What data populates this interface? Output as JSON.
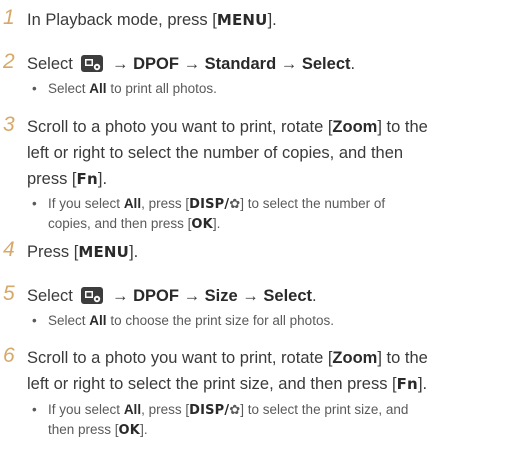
{
  "steps": [
    {
      "num": "1",
      "parts": [
        "In Playback mode, press [",
        "MENU",
        "]."
      ]
    },
    {
      "num": "2",
      "parts": [
        "Select",
        "→",
        "DPOF",
        "→",
        "Standard",
        "→",
        "Select",
        "."
      ],
      "icon": "print-settings-icon",
      "sub": [
        "Select",
        "All",
        "to print all photos."
      ]
    },
    {
      "num": "3",
      "lines": [
        "Scroll to a photo you want to print, rotate [",
        "Zoom",
        "] to the",
        "left or right to select the number of copies, and then",
        "press [",
        "Fn",
        "]."
      ],
      "sub": [
        "If you select",
        "All",
        ", press [",
        "DISP",
        "/",
        "✿",
        "] to select the number of",
        "copies, and then press [",
        "OK",
        "]."
      ]
    },
    {
      "num": "4",
      "parts": [
        "Press [",
        "MENU",
        "]."
      ]
    },
    {
      "num": "5",
      "parts": [
        "Select",
        "→",
        "DPOF",
        "→",
        "Size",
        "→",
        "Select",
        "."
      ],
      "icon": "print-settings-icon",
      "sub": [
        "Select",
        "All",
        "to choose the print size for all photos."
      ]
    },
    {
      "num": "6",
      "lines": [
        "Scroll to a photo you want to print, rotate [",
        "Zoom",
        "] to the",
        "left or right to select the print size, and then press [",
        "Fn",
        "]."
      ],
      "sub": [
        "If you select",
        "All",
        ", press [",
        "DISP",
        "/",
        "✿",
        "] to select the print size, and",
        "then press [",
        "OK",
        "]."
      ]
    }
  ],
  "colors": {
    "step_number": "#d6a96a",
    "text": "#3a3a3a",
    "icon_bg": "#3d3d3d"
  }
}
